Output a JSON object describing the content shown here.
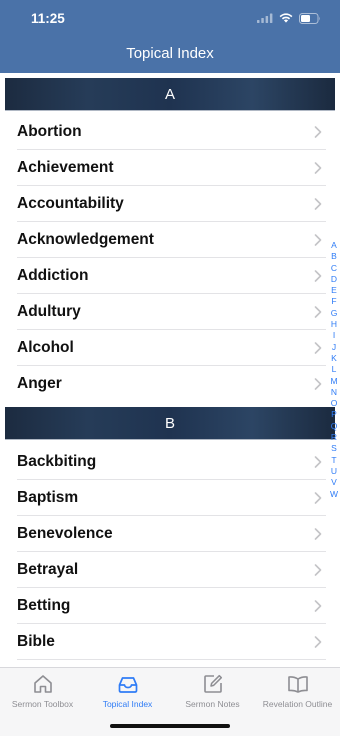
{
  "status_bar": {
    "time": "11:25"
  },
  "header": {
    "title": "Topical Index"
  },
  "sections": [
    {
      "letter": "A",
      "items": [
        "Abortion",
        "Achievement",
        "Accountability",
        "Acknowledgement",
        "Addiction",
        "Adultury",
        "Alcohol",
        "Anger"
      ]
    },
    {
      "letter": "B",
      "items": [
        "Backbiting",
        "Baptism",
        "Benevolence",
        "Betrayal",
        "Betting",
        "Bible"
      ]
    }
  ],
  "index_letters": [
    "A",
    "B",
    "C",
    "D",
    "E",
    "F",
    "G",
    "H",
    "I",
    "J",
    "K",
    "L",
    "M",
    "N",
    "O",
    "P",
    "Q",
    "R",
    "S",
    "T",
    "U",
    "V",
    "W"
  ],
  "tabbar": {
    "tabs": [
      {
        "label": "Sermon Toolbox",
        "icon": "home-icon",
        "active": false
      },
      {
        "label": "Topical Index",
        "icon": "inbox-icon",
        "active": true
      },
      {
        "label": "Sermon Notes",
        "icon": "edit-icon",
        "active": false
      },
      {
        "label": "Revelation Outline",
        "icon": "book-icon",
        "active": false
      }
    ]
  },
  "colors": {
    "header": "#4a72a8",
    "accent": "#2f7cf6",
    "section_bg": "#1f3350"
  }
}
